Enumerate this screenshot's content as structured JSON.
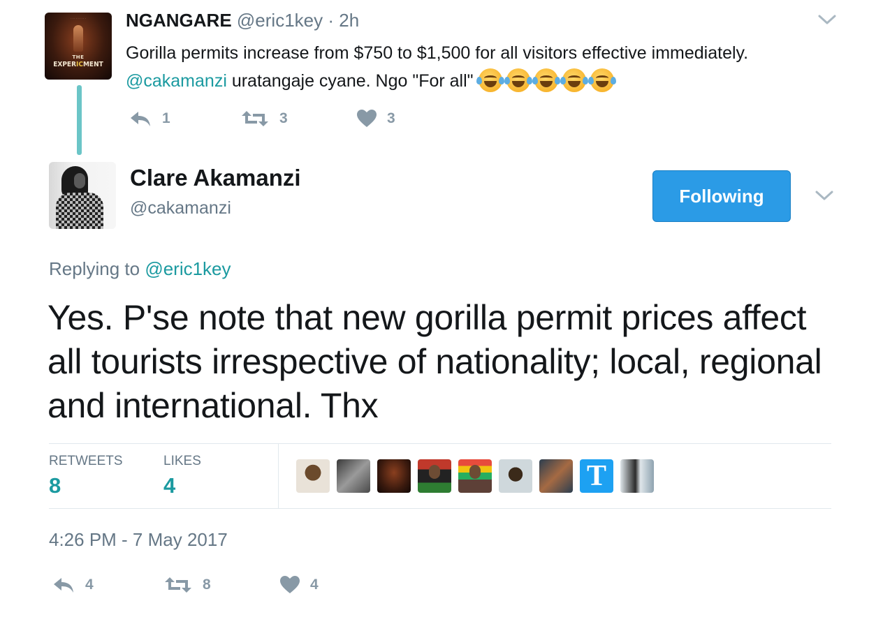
{
  "parent_tweet": {
    "avatar": {
      "kind": "movie-poster",
      "title_line1": "THE",
      "title_line2_pre": "EXPER",
      "title_line2_hl": "IC",
      "title_line2_post": "MENT"
    },
    "display_name": "NGANGARE",
    "handle": "@eric1key",
    "separator": "·",
    "time": "2h",
    "text_line1": "Gorilla permits increase from $750 to $1,500 for all visitors effective immediately.",
    "mention": "@cakamanzi",
    "text_line2": " uratangaje cyane. Ngo \"For all\"",
    "emoji_name": "face-with-tears-of-joy",
    "emoji_count": 5,
    "actions": {
      "replies": "1",
      "retweets": "3",
      "likes": "3"
    }
  },
  "main_tweet": {
    "display_name": "Clare Akamanzi",
    "handle": "@cakamanzi",
    "follow_button_label": "Following",
    "replying_prefix": "Replying to ",
    "replying_handle": "@eric1key",
    "text": "Yes. P'se note that new gorilla permit prices affect all tourists irrespective of nationality; local, regional and international. Thx",
    "stats": {
      "retweets_label": "RETWEETS",
      "retweets_value": "8",
      "likes_label": "LIKES",
      "likes_value": "4"
    },
    "liker_avatars": 10,
    "liker_avatar_letter": "T",
    "timestamp": "4:26 PM - 7 May 2017",
    "actions": {
      "replies": "4",
      "retweets": "8",
      "likes": "4"
    }
  },
  "colors": {
    "accent_teal": "#1b9aa0",
    "button_blue": "#2b9be6",
    "muted": "#657786",
    "icon_grey": "#8899a6",
    "thread_line": "#6bc5c7"
  }
}
